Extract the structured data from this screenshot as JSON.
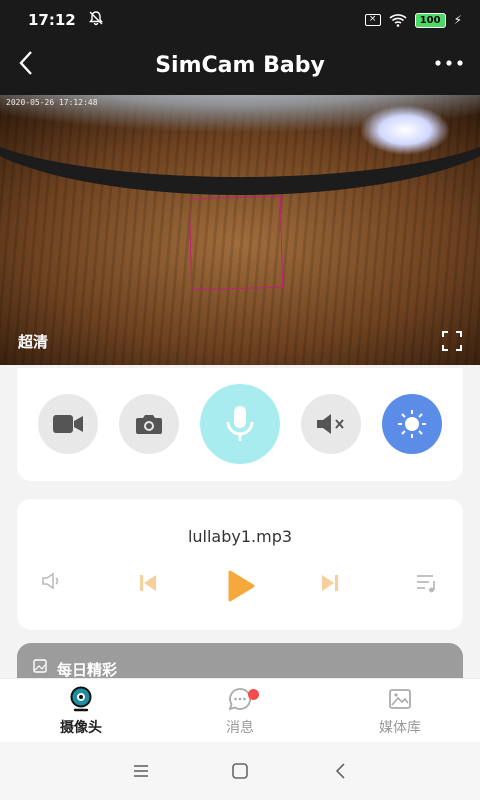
{
  "status": {
    "time": "17:12",
    "battery": "100"
  },
  "appbar": {
    "title": "SimCam Baby"
  },
  "video": {
    "timestamp": "2020-05-26 17:12:48",
    "quality": "超清"
  },
  "controls": {
    "icons": [
      "video-record-icon",
      "snapshot-icon",
      "microphone-icon",
      "mute-icon",
      "light-icon"
    ]
  },
  "player": {
    "track": "lullaby1.mp3"
  },
  "daily": {
    "label": "每日精彩"
  },
  "tabs": [
    {
      "label": "摄像头",
      "icon": "camera-icon"
    },
    {
      "label": "消息",
      "icon": "message-icon"
    },
    {
      "label": "媒体库",
      "icon": "gallery-icon"
    }
  ],
  "colors": {
    "accent_cyan": "#a9ecef",
    "accent_blue": "#5b8de8",
    "accent_orange": "#f6a93b"
  }
}
